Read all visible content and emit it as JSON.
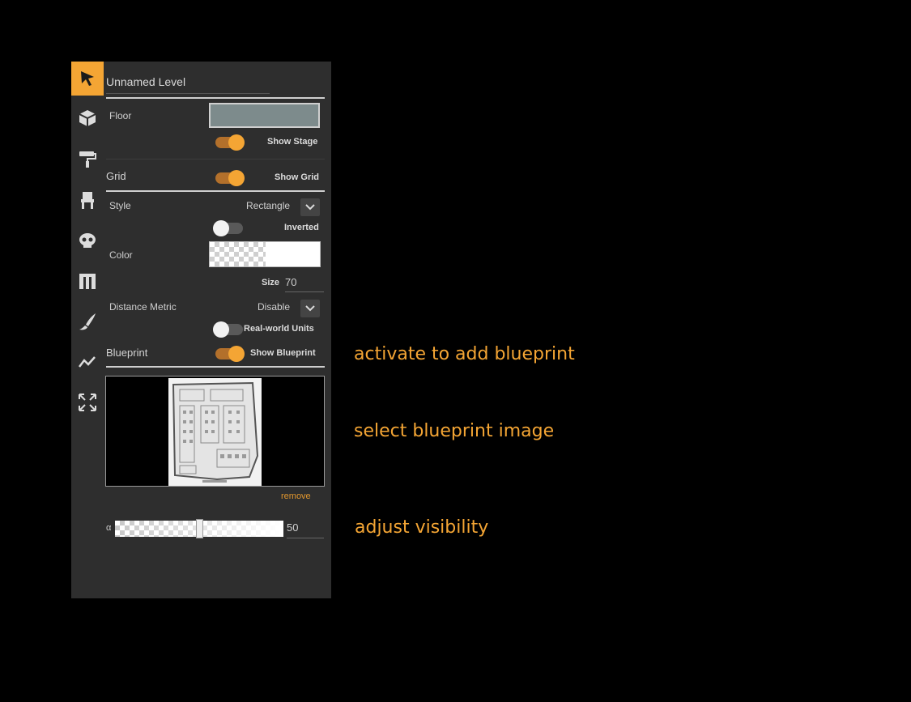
{
  "level": {
    "name": "Unnamed Level"
  },
  "toolbar": {
    "tools": [
      {
        "icon": "select-arrow-icon",
        "active": true
      },
      {
        "icon": "cube-icon",
        "active": false
      },
      {
        "icon": "paint-roller-icon",
        "active": false
      },
      {
        "icon": "chair-icon",
        "active": false
      },
      {
        "icon": "skull-icon",
        "active": false
      },
      {
        "icon": "wall-icon",
        "active": false
      },
      {
        "icon": "brush-icon",
        "active": false
      },
      {
        "icon": "path-icon",
        "active": false
      },
      {
        "icon": "expand-icon",
        "active": false
      }
    ]
  },
  "floor": {
    "label": "Floor",
    "color": "#7d8b8c",
    "show_stage_label": "Show Stage",
    "show_stage": true
  },
  "grid": {
    "label": "Grid",
    "show_grid_label": "Show Grid",
    "show_grid": true,
    "style_label": "Style",
    "style_value": "Rectangle",
    "inverted_label": "Inverted",
    "inverted": false,
    "color_label": "Color",
    "size_label": "Size",
    "size_value": "70",
    "distance_label": "Distance Metric",
    "distance_value": "Disable",
    "realworld_label": "Real-world Units",
    "realworld": false
  },
  "blueprint": {
    "label": "Blueprint",
    "show_label": "Show Blueprint",
    "show": true,
    "remove_label": "remove",
    "alpha_label": "α",
    "alpha_value": "50",
    "alpha_fraction": 0.5
  },
  "annotations": {
    "activate": "activate to add blueprint",
    "select": "select blueprint image",
    "adjust": "adjust visibility"
  },
  "colors": {
    "accent": "#f4a534",
    "panel": "#2e2e2e",
    "background": "#000000"
  }
}
